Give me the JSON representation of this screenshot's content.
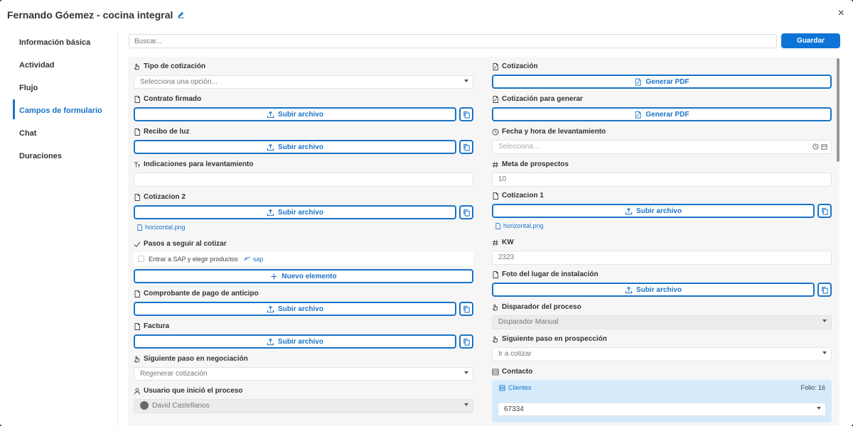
{
  "header": {
    "title": "Fernando Góemez - cocina integral",
    "close": "×"
  },
  "sidebar": {
    "items": [
      {
        "label": "Información básica"
      },
      {
        "label": "Actividad"
      },
      {
        "label": "Flujo"
      },
      {
        "label": "Campos de formulario"
      },
      {
        "label": "Chat"
      },
      {
        "label": "Duraciones"
      }
    ],
    "active_index": 3
  },
  "toolbar": {
    "search_placeholder": "Buscar...",
    "save_label": "Guardar"
  },
  "common": {
    "upload_label": "Subir archivo",
    "pdf_label": "Generar PDF",
    "accent_color": "#1a73c8",
    "save_color": "#0d74d6"
  },
  "left": {
    "tipo_cotizacion": {
      "label": "Tipo de cotización",
      "placeholder": "Selecciona una opción..."
    },
    "contrato": {
      "label": "Contrato firmado"
    },
    "recibo": {
      "label": "Recibo de luz"
    },
    "indicaciones": {
      "label": "Indicaciones para levantamiento",
      "value": ""
    },
    "cotizacion2": {
      "label": "Cotizacion 2",
      "file": "horizontal.png"
    },
    "pasos": {
      "label": "Pasos a seguir al cotizar",
      "item": "Entrar a SAP y elegir productos",
      "link": "sap",
      "new_item": "Nuevo elemento"
    },
    "comprobante": {
      "label": "Comprobante de pago de anticipo"
    },
    "factura": {
      "label": "Factura"
    },
    "siguiente_negociacion": {
      "label": "Siguiente paso en negociación",
      "value": "Regenerar cotización"
    },
    "usuario": {
      "label": "Usuario que inició el proceso",
      "value": "David Castellanos"
    }
  },
  "right": {
    "cotizacion": {
      "label": "Cotización"
    },
    "cotizacion_generar": {
      "label": "Cotización para generar"
    },
    "fecha": {
      "label": "Fecha y hora de levantamiento",
      "placeholder": "Selecciona..."
    },
    "meta": {
      "label": "Meta de prospectos",
      "value": "10"
    },
    "cotizacion1": {
      "label": "Cotizacion 1",
      "file": "horizontal.png"
    },
    "kw": {
      "label": "KW",
      "value": "2323"
    },
    "foto": {
      "label": "Foto del lugar de instalación"
    },
    "disparador": {
      "label": "Disparador del proceso",
      "value": "Disparador Manual"
    },
    "siguiente_prospeccion": {
      "label": "Siguiente paso en prospección",
      "value": "Ir a cotizar"
    },
    "contacto": {
      "label": "Contacto",
      "section": "Clientes",
      "folio": "Folio: 16",
      "value": "67334"
    }
  }
}
